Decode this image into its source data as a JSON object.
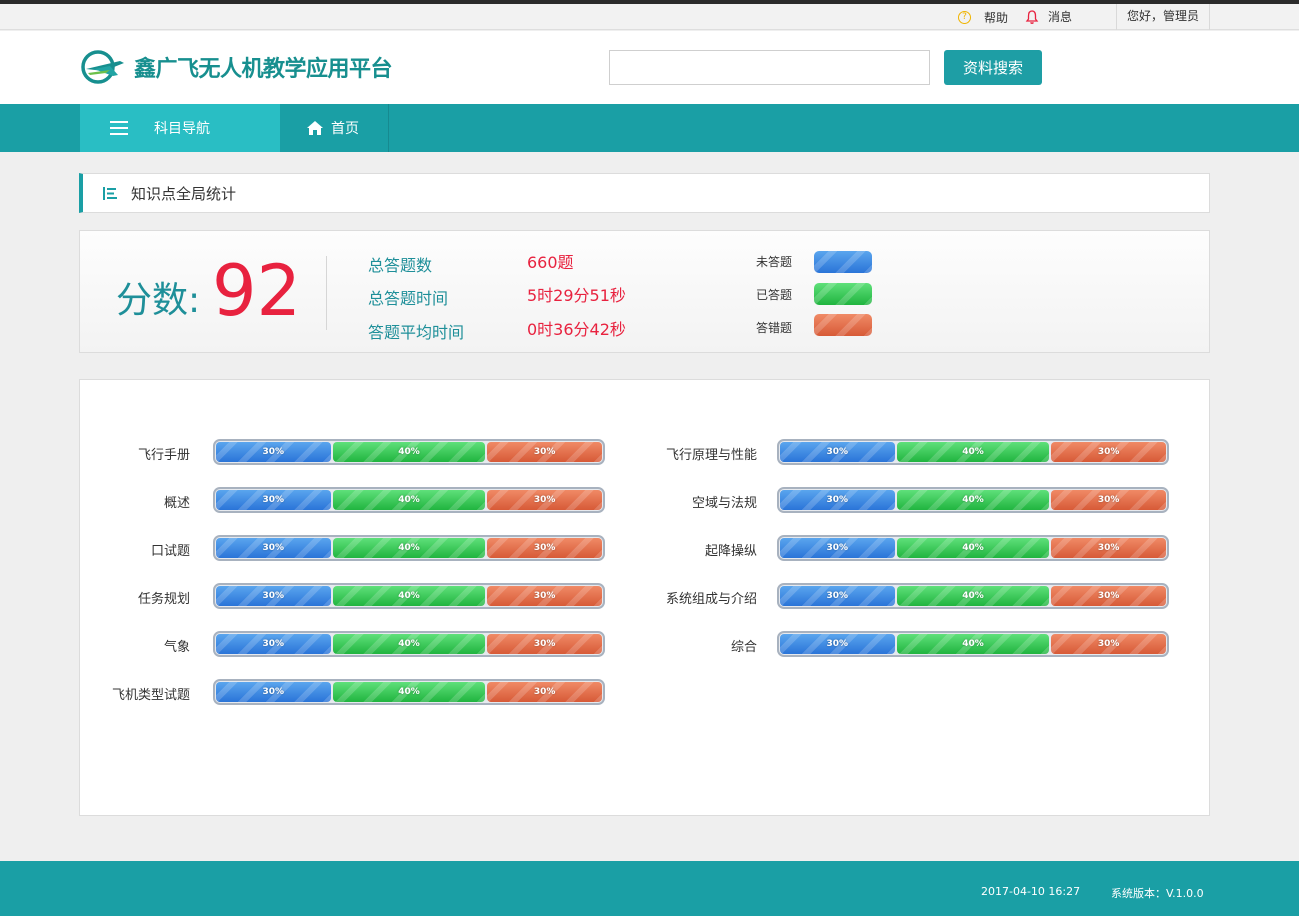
{
  "topbar": {
    "help_label": "帮助",
    "messages_label": "消息",
    "user_greeting": "您好，管理员"
  },
  "header": {
    "logo_text": "鑫广飞无人机教学应用平台",
    "search_placeholder": "",
    "search_button": "资料搜索"
  },
  "nav": {
    "subjects_label": "科目导航",
    "home_label": "首页"
  },
  "section": {
    "title": "知识点全局统计"
  },
  "summary": {
    "score_label": "分数:",
    "score_value": "92",
    "stats": [
      {
        "label": "总答题数",
        "value": "660题"
      },
      {
        "label": "总答题时间",
        "value": "5时29分51秒"
      },
      {
        "label": "答题平均时间",
        "value": "0时36分42秒"
      }
    ],
    "legend": [
      {
        "label": "未答题",
        "color": "#2f7fe0"
      },
      {
        "label": "已答题",
        "color": "#29c04a"
      },
      {
        "label": "答错题",
        "color": "#dd6a45"
      }
    ]
  },
  "subjects": [
    {
      "name": "飞行手册",
      "segments": [
        30,
        40,
        30
      ],
      "labels": [
        "30%",
        "40%",
        "30%"
      ]
    },
    {
      "name": "概述",
      "segments": [
        30,
        40,
        30
      ],
      "labels": [
        "30%",
        "40%",
        "30%"
      ]
    },
    {
      "name": "口试题",
      "segments": [
        30,
        40,
        30
      ],
      "labels": [
        "30%",
        "40%",
        "30%"
      ]
    },
    {
      "name": "任务规划",
      "segments": [
        30,
        40,
        30
      ],
      "labels": [
        "30%",
        "40%",
        "30%"
      ]
    },
    {
      "name": "气象",
      "segments": [
        30,
        40,
        30
      ],
      "labels": [
        "30%",
        "40%",
        "30%"
      ]
    },
    {
      "name": "飞机类型试题",
      "segments": [
        30,
        40,
        30
      ],
      "labels": [
        "30%",
        "40%",
        "30%"
      ]
    },
    {
      "name": "飞行原理与性能",
      "segments": [
        30,
        40,
        30
      ],
      "labels": [
        "30%",
        "40%",
        "30%"
      ]
    },
    {
      "name": "空域与法规",
      "segments": [
        30,
        40,
        30
      ],
      "labels": [
        "30%",
        "40%",
        "30%"
      ]
    },
    {
      "name": "起降操纵",
      "segments": [
        30,
        40,
        30
      ],
      "labels": [
        "30%",
        "40%",
        "30%"
      ]
    },
    {
      "name": "系统组成与介绍",
      "segments": [
        30,
        40,
        30
      ],
      "labels": [
        "30%",
        "40%",
        "30%"
      ]
    },
    {
      "name": "综合",
      "segments": [
        30,
        40,
        30
      ],
      "labels": [
        "30%",
        "40%",
        "30%"
      ]
    }
  ],
  "footer": {
    "datetime": "2017-04-10  16:27",
    "version": "系统版本：V.1.0.0"
  }
}
